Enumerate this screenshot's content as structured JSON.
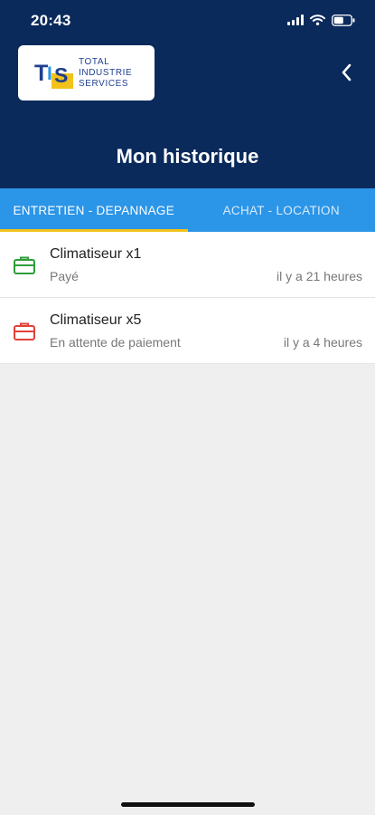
{
  "status_bar": {
    "time": "20:43",
    "icons": [
      "signal-icon",
      "wifi-icon",
      "battery-icon"
    ]
  },
  "header": {
    "logo": {
      "mark": "TIS",
      "lines": [
        "TOTAL",
        "INDUSTRIE",
        "SERVICES"
      ]
    },
    "back_icon": "chevron-left-icon",
    "title": "Mon historique"
  },
  "tabs": [
    {
      "label": "ENTRETIEN - DEPANNAGE",
      "active": true
    },
    {
      "label": "ACHAT - LOCATION",
      "active": false
    }
  ],
  "items": [
    {
      "title": "Climatiseur x1",
      "status": "Payé",
      "time": "il y a 21 heures",
      "icon": "briefcase-icon",
      "color": "#2e9d3a"
    },
    {
      "title": "Climatiseur x5",
      "status": "En attente de paiement",
      "time": "il y a 4 heures",
      "icon": "briefcase-icon",
      "color": "#e0413a"
    }
  ],
  "colors": {
    "header_bg": "#0a2a5c",
    "tab_bg": "#2b95e8",
    "tab_indicator": "#f2c21b",
    "paid": "#2e9d3a",
    "pending": "#e0413a"
  }
}
